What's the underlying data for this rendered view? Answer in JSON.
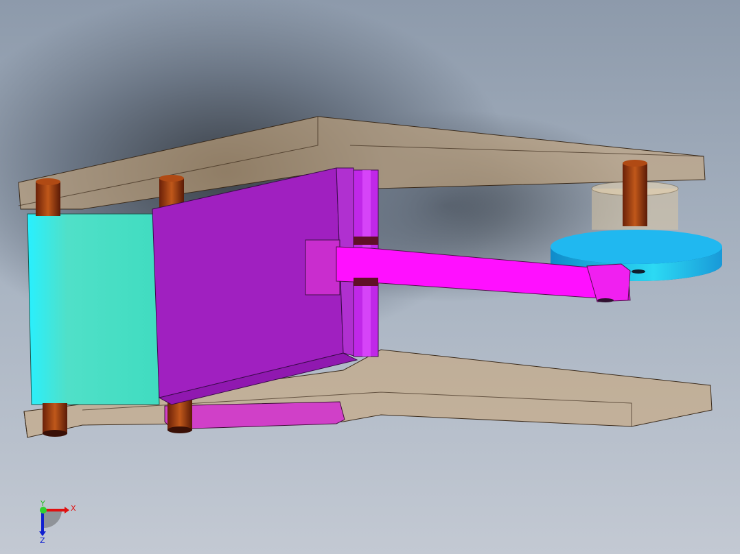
{
  "viewport": {
    "model": "linkage-mechanism-assembly",
    "colors": {
      "plate": "#c9a77a",
      "pin": "#a3420f",
      "cyan_block": "#40e0c0",
      "purple_plate": "#a020c0",
      "magenta_arm": "#ff00ff",
      "disc": "#20b8f0"
    }
  },
  "triad": {
    "x_label": "X",
    "y_label": "Y",
    "z_label": "Z",
    "x_color": "#e01010",
    "y_color": "#20c020",
    "z_color": "#1020d0"
  }
}
